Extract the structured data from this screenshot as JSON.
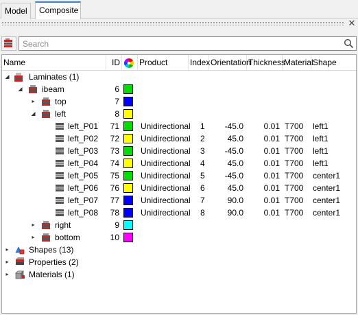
{
  "tabs": [
    {
      "label": "Model"
    },
    {
      "label": "Composite"
    }
  ],
  "close_glyph": "✕",
  "search": {
    "placeholder": "Search",
    "value": ""
  },
  "columns": {
    "name": "Name",
    "id": "ID",
    "product": "Product",
    "index": "Index",
    "orientation": "Orientation",
    "thickness": "Thickness",
    "material": "Material",
    "shape": "Shape"
  },
  "tree": {
    "laminates": {
      "label": "Laminates (1)"
    },
    "ibeam": {
      "label": "ibeam",
      "id": "6",
      "color": "#00dd00"
    },
    "top": {
      "label": "top",
      "id": "7",
      "color": "#0000ff"
    },
    "left": {
      "label": "left",
      "id": "8",
      "color": "#ffff00"
    },
    "plies": [
      {
        "label": "left_P01",
        "id": "71",
        "color": "#00dd00",
        "product": "Unidirectional",
        "index": "1",
        "orientation": "-45.0",
        "thickness": "0.01",
        "material": "T700",
        "shape": "left1"
      },
      {
        "label": "left_P02",
        "id": "72",
        "color": "#ffff00",
        "product": "Unidirectional",
        "index": "2",
        "orientation": "45.0",
        "thickness": "0.01",
        "material": "T700",
        "shape": "left1"
      },
      {
        "label": "left_P03",
        "id": "73",
        "color": "#00dd00",
        "product": "Unidirectional",
        "index": "3",
        "orientation": "-45.0",
        "thickness": "0.01",
        "material": "T700",
        "shape": "left1"
      },
      {
        "label": "left_P04",
        "id": "74",
        "color": "#ffff00",
        "product": "Unidirectional",
        "index": "4",
        "orientation": "45.0",
        "thickness": "0.01",
        "material": "T700",
        "shape": "left1"
      },
      {
        "label": "left_P05",
        "id": "75",
        "color": "#00dd00",
        "product": "Unidirectional",
        "index": "5",
        "orientation": "-45.0",
        "thickness": "0.01",
        "material": "T700",
        "shape": "center1"
      },
      {
        "label": "left_P06",
        "id": "76",
        "color": "#ffff00",
        "product": "Unidirectional",
        "index": "6",
        "orientation": "45.0",
        "thickness": "0.01",
        "material": "T700",
        "shape": "center1"
      },
      {
        "label": "left_P07",
        "id": "77",
        "color": "#0000ff",
        "product": "Unidirectional",
        "index": "7",
        "orientation": "90.0",
        "thickness": "0.01",
        "material": "T700",
        "shape": "center1"
      },
      {
        "label": "left_P08",
        "id": "78",
        "color": "#0000ff",
        "product": "Unidirectional",
        "index": "8",
        "orientation": "90.0",
        "thickness": "0.01",
        "material": "T700",
        "shape": "center1"
      }
    ],
    "right": {
      "label": "right",
      "id": "9",
      "color": "#00ffff"
    },
    "bottom": {
      "label": "bottom",
      "id": "10",
      "color": "#ff00ff"
    },
    "shapes": {
      "label": "Shapes (13)"
    },
    "properties": {
      "label": "Properties (2)"
    },
    "materials": {
      "label": "Materials (1)"
    }
  }
}
